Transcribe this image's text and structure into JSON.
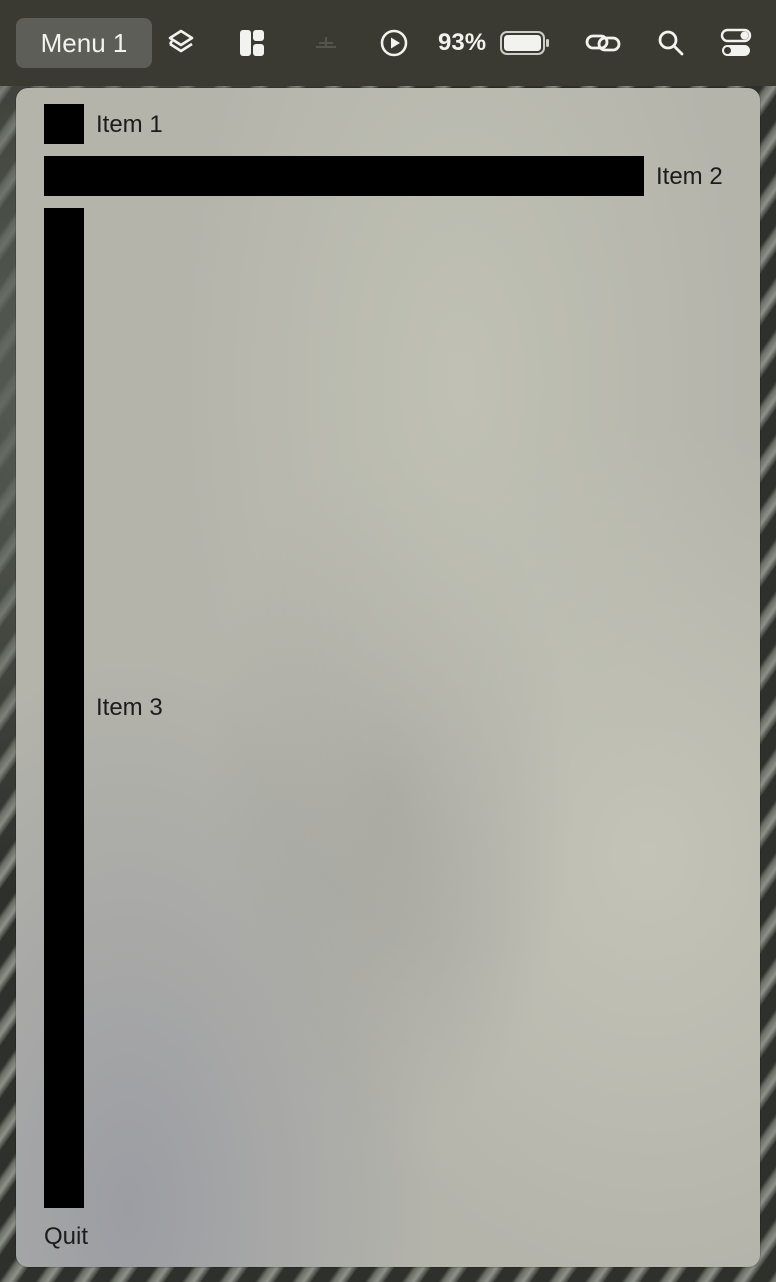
{
  "menubar": {
    "menu_label": "Menu 1",
    "battery_percent": "93%",
    "icons": [
      "layers-icon",
      "layout-panels-icon",
      "dimmed-status-icon",
      "play-circle-icon",
      "battery-icon",
      "link-icon",
      "search-icon",
      "control-center-toggles-icon"
    ]
  },
  "menu": {
    "items": [
      {
        "label": "Item 1"
      },
      {
        "label": "Item 2"
      },
      {
        "label": "Item 3"
      }
    ],
    "quit_label": "Quit"
  }
}
